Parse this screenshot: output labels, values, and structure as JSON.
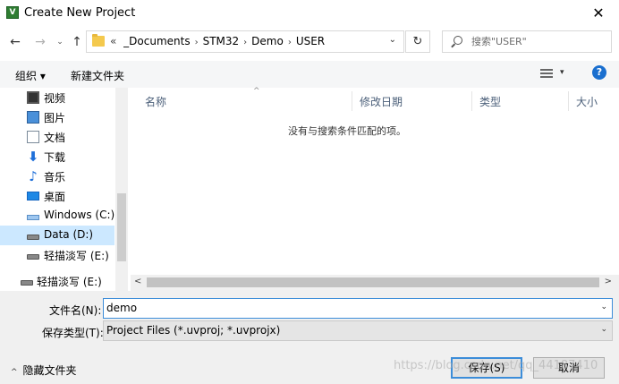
{
  "window": {
    "title": "Create New Project",
    "app_icon_glyph": "V",
    "close_glyph": "✕"
  },
  "nav": {
    "back_glyph": "←",
    "forward_glyph": "→",
    "recent_glyph": "⌄",
    "up_glyph": "↑",
    "breadcrumb_overflow": "«",
    "breadcrumbs": [
      "_Documents",
      "STM32",
      "Demo",
      "USER"
    ],
    "crumb_sep": "›",
    "refresh_glyph": "↻",
    "dropdown_glyph": "⌄",
    "search_placeholder": "搜索\"USER\""
  },
  "toolbar": {
    "organize_label": "组织 ▾",
    "new_folder_label": "新建文件夹",
    "view_dd_glyph": "▾",
    "help_glyph": "?"
  },
  "sidebar": {
    "items": [
      {
        "label": "视频",
        "icon": "video-icon"
      },
      {
        "label": "图片",
        "icon": "pictures-icon"
      },
      {
        "label": "文档",
        "icon": "documents-icon"
      },
      {
        "label": "下载",
        "icon": "downloads-icon",
        "glyph": "⬇"
      },
      {
        "label": "音乐",
        "icon": "music-icon",
        "glyph": "♪"
      },
      {
        "label": "桌面",
        "icon": "desktop-icon"
      },
      {
        "label": "Windows (C:)",
        "icon": "windows-drive-icon"
      },
      {
        "label": "Data (D:)",
        "icon": "drive-icon",
        "selected": true
      },
      {
        "label": "轻描淡写 (E:)",
        "icon": "drive-icon"
      },
      {
        "label": "轻描淡写 (E:)",
        "icon": "drive-icon"
      }
    ]
  },
  "files": {
    "columns": [
      "名称",
      "修改日期",
      "类型",
      "大小"
    ],
    "sort_glyph": "^",
    "empty_message": "没有与搜索条件匹配的项。",
    "scroll_left": "<",
    "scroll_right": ">"
  },
  "form": {
    "filename_label": "文件名(N):",
    "filename_value": "demo",
    "filetype_label": "保存类型(T):",
    "filetype_value": "Project Files (*.uvproj; *.uvprojx)",
    "dd_glyph": "⌄"
  },
  "footer": {
    "hide_folders_label": "隐藏文件夹",
    "hide_chevron": "^",
    "save_label": "保存(S)",
    "cancel_label": "取消",
    "watermark": "https://blog.csdn.net/qq_44187410"
  },
  "colors": {
    "accent": "#3c8dd9",
    "selected_bg": "#cce8ff",
    "toolbar_bg": "#f5f6f7",
    "bottom_bg": "#f0f0f0"
  }
}
